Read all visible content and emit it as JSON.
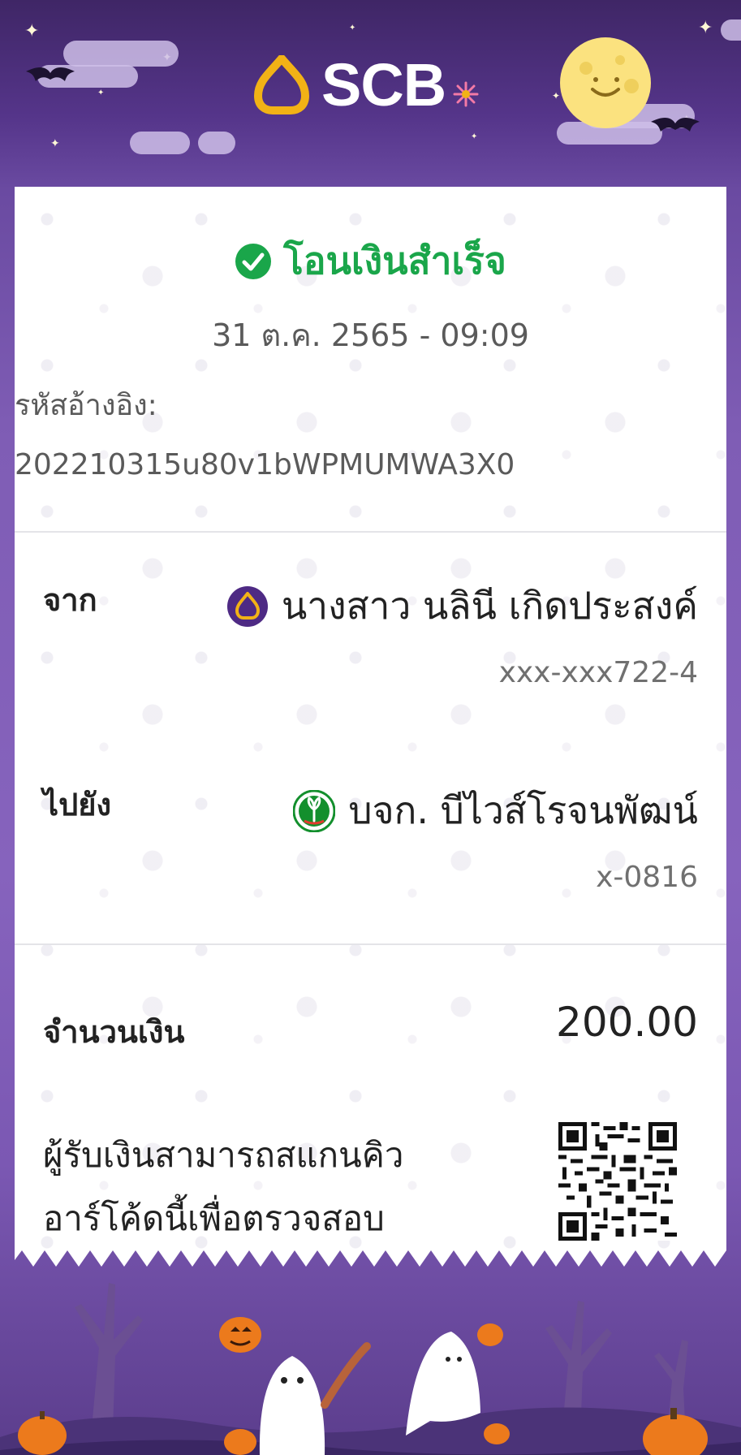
{
  "brand": {
    "name": "SCB"
  },
  "receipt": {
    "status": "โอนเงินสำเร็จ",
    "datetime": "31 ต.ค. 2565 - 09:09",
    "reference_label": "รหัสอ้างอิง:",
    "reference_value": "202210315u80v1bWPMUMWA3X0"
  },
  "sender": {
    "label": "จาก",
    "name": "นางสาว นลินี เกิดประสงค์",
    "account": "xxx-xxx722-4",
    "bank_icon": "scb-bank-icon"
  },
  "recipient": {
    "label": "ไปยัง",
    "name": "บจก. บีไวส์โรจนพัฒน์",
    "account": "x-0816",
    "bank_icon": "kbank-bank-icon"
  },
  "amount": {
    "label": "จำนวนเงิน",
    "value": "200.00"
  },
  "qr": {
    "note_line1": "ผู้รับเงินสามารถสแกนคิว",
    "note_line2": "อาร์โค้ดนี้เพื่อตรวจสอบ"
  },
  "colors": {
    "success_green": "#1aa64a",
    "scb_purple": "#4e2a84",
    "scb_gold": "#f2b216",
    "kbank_green": "#138f2d"
  }
}
